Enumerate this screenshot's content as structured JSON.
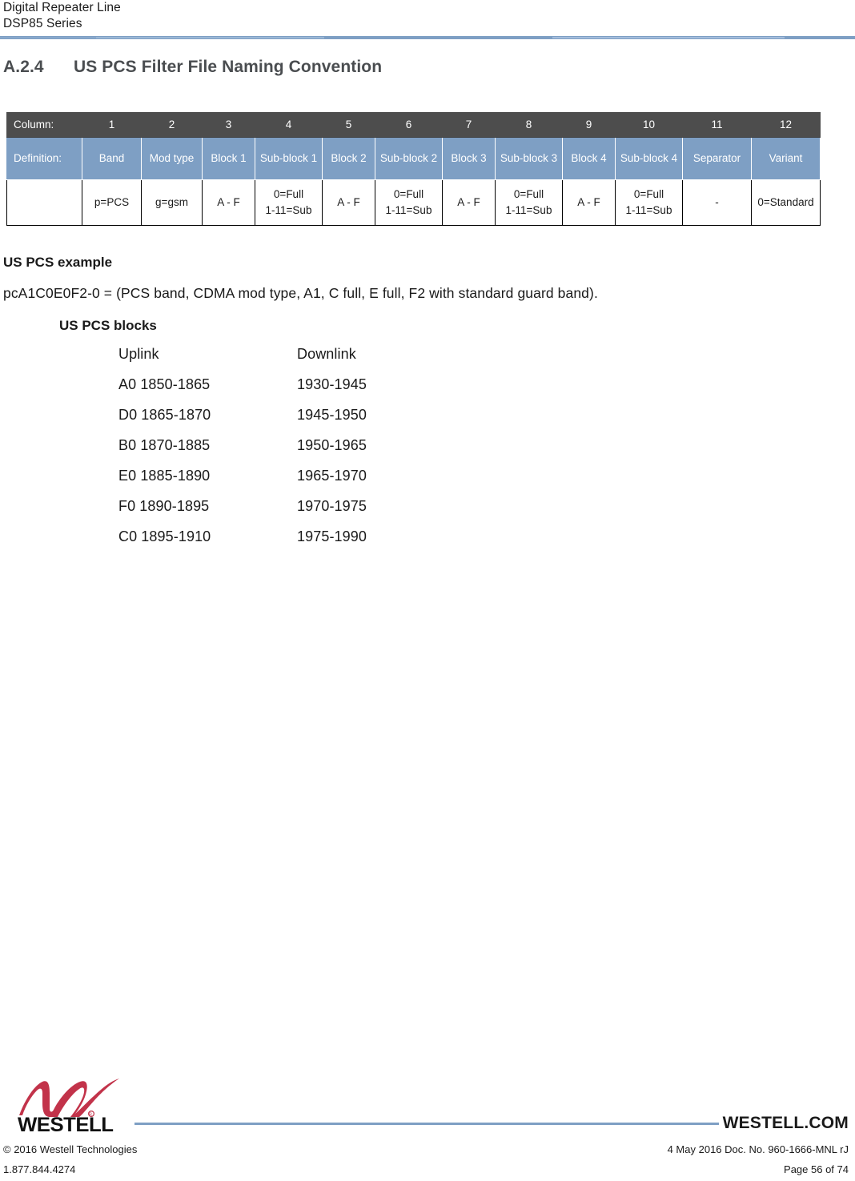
{
  "header": {
    "line1": "Digital Repeater Line",
    "line2": "DSP85 Series",
    "rule_color": "#7e9fc4"
  },
  "section": {
    "number": "A.2.4",
    "title": "US PCS Filter File Naming Convention"
  },
  "table": {
    "header_bg": "#4d4d4d",
    "definition_bg": "#7e9fc4",
    "row_labels": {
      "column": "Column:",
      "definition": "Definition:",
      "values": ""
    },
    "columns": [
      "1",
      "2",
      "3",
      "4",
      "5",
      "6",
      "7",
      "8",
      "9",
      "10",
      "11",
      "12"
    ],
    "definitions": [
      "Band",
      "Mod type",
      "Block 1",
      "Sub-block 1",
      "Block 2",
      "Sub-block 2",
      "Block 3",
      "Sub-block 3",
      "Block 4",
      "Sub-block 4",
      "Separator",
      "Variant"
    ],
    "values": [
      [
        "p=PCS"
      ],
      [
        "g=gsm"
      ],
      [
        "A - F"
      ],
      [
        "0=Full",
        "1-11=Sub"
      ],
      [
        "A - F"
      ],
      [
        "0=Full",
        "1-11=Sub"
      ],
      [
        "A - F"
      ],
      [
        "0=Full",
        "1-11=Sub"
      ],
      [
        "A - F"
      ],
      [
        "0=Full",
        "1-11=Sub"
      ],
      [
        "-"
      ],
      [
        "0=Standard"
      ]
    ]
  },
  "example": {
    "heading": "US PCS example",
    "text": "pcA1C0E0F2-0 = (PCS band, CDMA mod type, A1, C full, E full, F2 with standard guard band)."
  },
  "blocks": {
    "heading": "US PCS blocks",
    "col_headers": {
      "uplink": "Uplink",
      "downlink": "Downlink"
    },
    "rows": [
      {
        "uplink": "A0 1850-1865",
        "downlink": "1930-1945"
      },
      {
        "uplink": "D0 1865-1870",
        "downlink": "1945-1950"
      },
      {
        "uplink": "B0 1870-1885",
        "downlink": "1950-1965"
      },
      {
        "uplink": "E0 1885-1890",
        "downlink": "1965-1970"
      },
      {
        "uplink": "F0 1890-1895",
        "downlink": "1970-1975"
      },
      {
        "uplink": "C0 1895-1910",
        "downlink": "1975-1990"
      }
    ]
  },
  "footer": {
    "logo_wordmark": "WESTELL",
    "logo_color": "#c2334a",
    "website": "WESTELL.COM",
    "copyright": "© 2016 Westell Technologies",
    "phone": "1.877.844.4274",
    "doc_info": "4 May 2016 Doc. No. 960-1666-MNL rJ",
    "page_info": "Page 56 of 74",
    "rule_color": "#7e9fc4"
  }
}
